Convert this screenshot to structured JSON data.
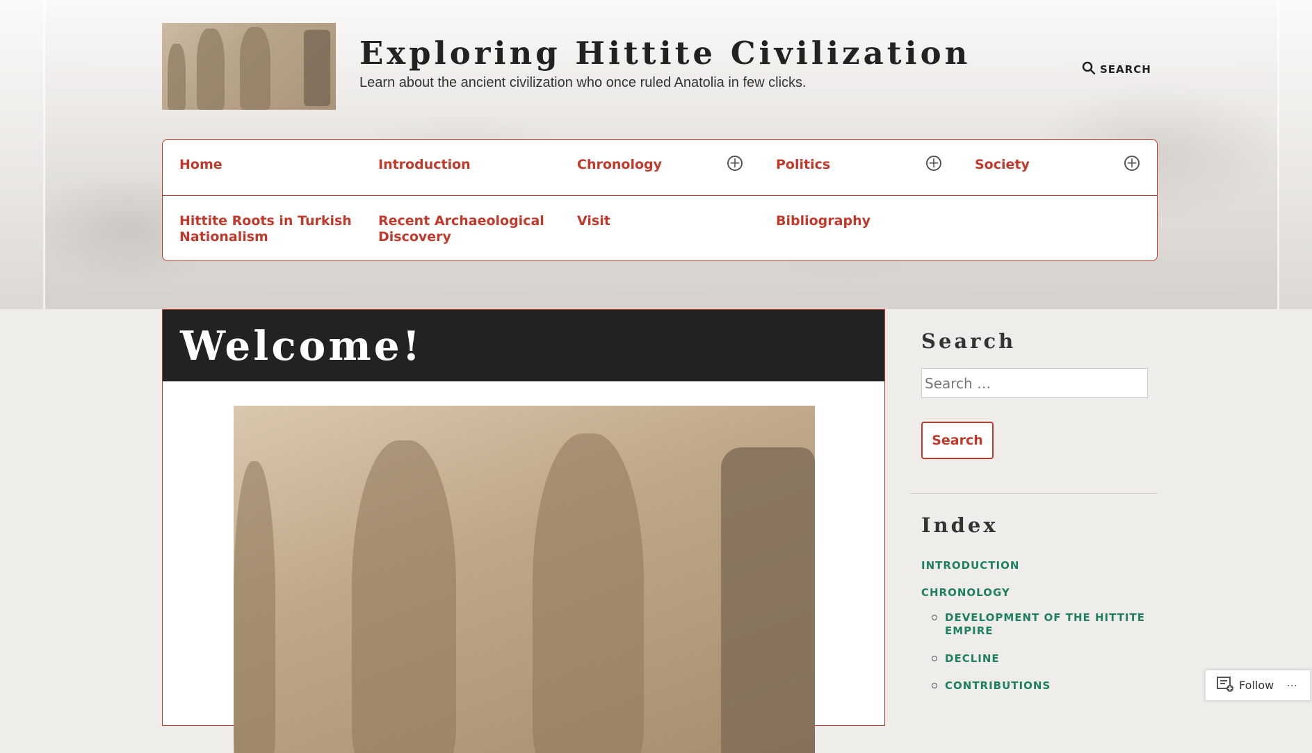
{
  "site": {
    "title": "Exploring Hittite Civilization",
    "description": "Learn about the ancient civilization who once ruled Anatolia in few clicks.",
    "search_toggle": "SEARCH"
  },
  "nav": {
    "row1": [
      {
        "label": "Home",
        "has_submenu": false
      },
      {
        "label": "Introduction",
        "has_submenu": false
      },
      {
        "label": "Chronology",
        "has_submenu": true
      },
      {
        "label": "Politics",
        "has_submenu": true
      },
      {
        "label": "Society",
        "has_submenu": true
      }
    ],
    "row2": [
      {
        "label": "Hittite Roots in Turkish Nationalism"
      },
      {
        "label": "Recent Archaeological Discovery"
      },
      {
        "label": "Visit"
      },
      {
        "label": "Bibliography"
      }
    ]
  },
  "post": {
    "title": "Welcome!"
  },
  "sidebar": {
    "search_widget": {
      "title": "Search",
      "placeholder": "Search …",
      "button": "Search"
    },
    "index_widget": {
      "title": "Index",
      "items": [
        {
          "label": "INTRODUCTION"
        },
        {
          "label": "CHRONOLOGY",
          "children": [
            {
              "label": "DEVELOPMENT OF THE HITTITE EMPIRE"
            },
            {
              "label": "DECLINE"
            },
            {
              "label": "CONTRIBUTIONS"
            }
          ]
        }
      ]
    }
  },
  "follow": {
    "label": "Follow",
    "more": "⋯"
  },
  "colors": {
    "accent": "#c0392b",
    "index_link": "#1e8060",
    "title_bar": "#222222"
  }
}
